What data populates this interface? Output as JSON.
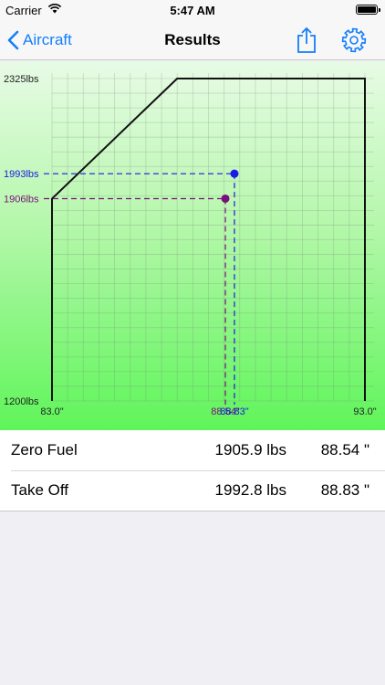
{
  "status_bar": {
    "carrier": "Carrier",
    "time": "5:47 AM"
  },
  "nav": {
    "back_label": "Aircraft",
    "title": "Results"
  },
  "colors": {
    "accent": "#147efb",
    "takeoff": "#1a1ae6",
    "zero_fuel": "#7a0f7a"
  },
  "chart_data": {
    "type": "scatter",
    "title": "",
    "xlabel": "",
    "ylabel": "",
    "xlim": [
      83.0,
      93.0
    ],
    "ylim": [
      1200,
      2325
    ],
    "x_tick_labels": {
      "min": "83.0\"",
      "max": "93.0\""
    },
    "y_tick_labels": {
      "min": "1200lbs",
      "max": "2325lbs"
    },
    "envelope": [
      {
        "x": 83.0,
        "y": 1200
      },
      {
        "x": 83.0,
        "y": 1906
      },
      {
        "x": 87.0,
        "y": 2325
      },
      {
        "x": 93.0,
        "y": 2325
      },
      {
        "x": 93.0,
        "y": 1200
      }
    ],
    "points": [
      {
        "name": "Zero Fuel",
        "x": 88.54,
        "y": 1906,
        "y_label": "1906lbs",
        "x_label": "88.54\"",
        "color": "#7a0f7a"
      },
      {
        "name": "Take Off",
        "x": 88.83,
        "y": 1993,
        "y_label": "1993lbs",
        "x_label": "88.83\"",
        "color": "#1a1ae6"
      }
    ],
    "grid": true
  },
  "results": [
    {
      "label": "Zero Fuel",
      "weight": "1905.9 lbs",
      "arm": "88.54 \""
    },
    {
      "label": "Take Off",
      "weight": "1992.8 lbs",
      "arm": "88.83 \""
    }
  ]
}
